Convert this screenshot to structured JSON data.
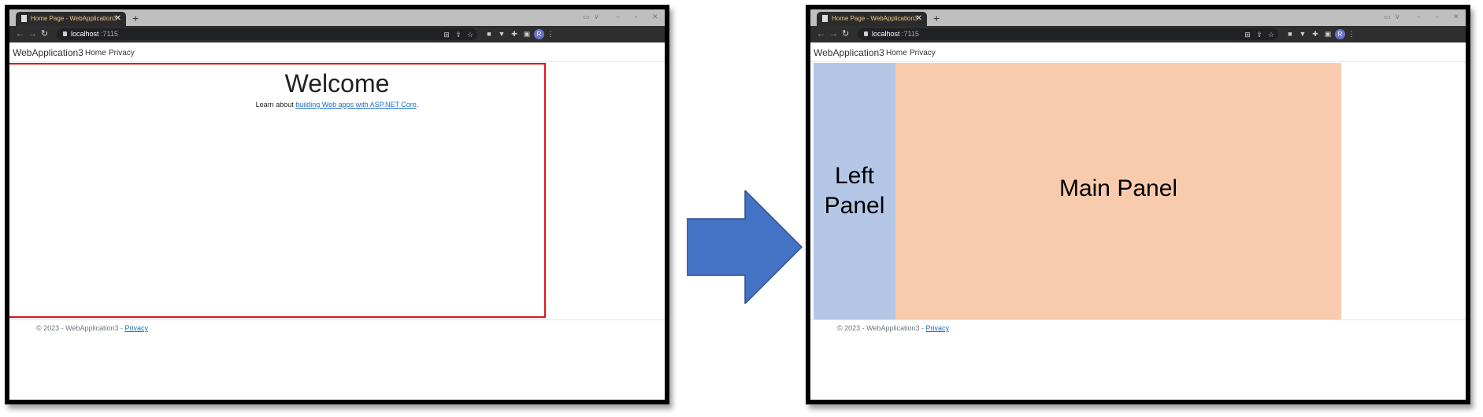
{
  "browser": {
    "tab_title": "Home Page - WebApplication3",
    "tab_close": "✕",
    "new_tab": "+",
    "url_host": "localhost",
    "url_port": ":7115"
  },
  "site": {
    "brand": "WebApplication3",
    "nav": [
      "Home",
      "Privacy"
    ],
    "footer_text": "© 2023 - WebApplication3 - ",
    "footer_link": "Privacy"
  },
  "before": {
    "heading": "Welcome",
    "lead_text": "Learn about ",
    "lead_link": "building Web apps with ASP.NET Core",
    "lead_end": "."
  },
  "after": {
    "left_panel": "Left\nPanel",
    "main_panel": "Main Panel"
  },
  "colors": {
    "highlight_border": "#e0141a",
    "left_panel": "#b4c7e7",
    "main_panel": "#f8cbad",
    "arrow": "#4472c4",
    "link": "#1b6ec2"
  },
  "icons": [
    "page-icon",
    "back-arrow-icon",
    "forward-arrow-icon",
    "reload-icon",
    "lock-icon",
    "translate-icon",
    "share-icon",
    "bookmark-star-icon",
    "extension-icon",
    "vpn-icon",
    "puzzle-icon",
    "sidepanel-icon",
    "profile-avatar",
    "menu-dots-icon",
    "arrow-right-icon"
  ]
}
